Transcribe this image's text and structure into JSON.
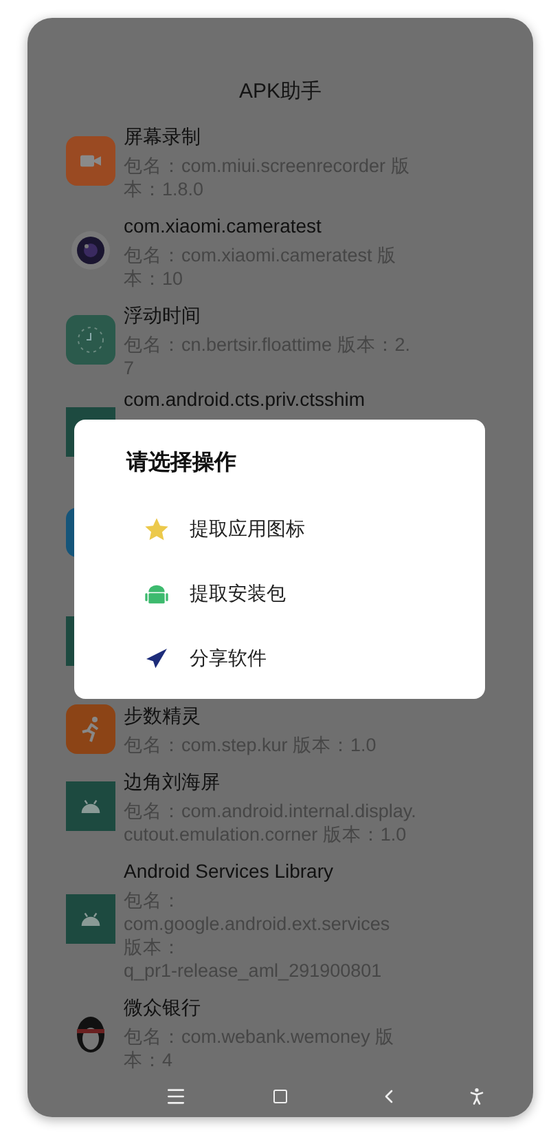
{
  "app_bar": {
    "title": "APK助手"
  },
  "apps": [
    {
      "kind": "recorder",
      "name": "屏幕录制",
      "detail": "包名：com.miui.screenrecorder 版本：1.8.0"
    },
    {
      "kind": "camera",
      "name": "com.xiaomi.cameratest",
      "detail": "包名：com.xiaomi.cameratest 版本：10"
    },
    {
      "kind": "clock",
      "name": "浮动时间",
      "detail": "包名：cn.bertsir.floattime 版本：2.7"
    },
    {
      "kind": "android",
      "name": "com.android.cts.priv.ctsshim"
    },
    {
      "kind": "blue"
    },
    {
      "kind": "android"
    },
    {
      "kind": "runner",
      "name": "步数精灵",
      "detail": "包名：com.step.kur 版本：1.0"
    },
    {
      "kind": "android",
      "name": "边角刘海屏",
      "detail": "包名：com.android.internal.display.cutout.emulation.corner 版本：1.0"
    },
    {
      "kind": "android",
      "name": "Android Services Library",
      "detail": "包名：\ncom.google.android.ext.services\n版本：\nq_pr1-release_aml_291900801"
    },
    {
      "kind": "penguin",
      "name": "微众银行",
      "detail": "包名：com.webank.wemoney 版本：4"
    }
  ],
  "dialog": {
    "title": "请选择操作",
    "options": [
      {
        "kind": "star",
        "label": "提取应用图标"
      },
      {
        "kind": "android",
        "label": "提取安装包"
      },
      {
        "kind": "plane",
        "label": "分享软件"
      }
    ]
  }
}
